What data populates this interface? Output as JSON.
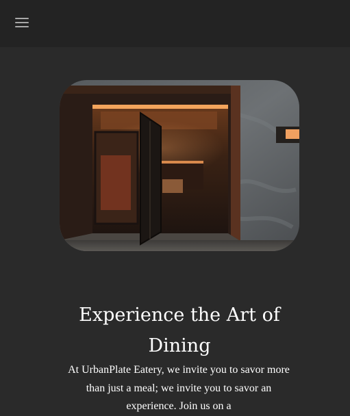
{
  "header": {
    "menu_icon": "hamburger-menu-icon"
  },
  "hero": {
    "image_subject": "restaurant-entrance-photo"
  },
  "main": {
    "headline": "Experience the Art of Dining",
    "intro": "At UrbanPlate Eatery, we invite you to savor more than just a meal; we invite you to savor an experience. Join us on a"
  },
  "colors": {
    "background": "#2a2a2a",
    "header_background": "#232323",
    "text": "#ffffff",
    "menu_icon": "#a8a8a8"
  }
}
